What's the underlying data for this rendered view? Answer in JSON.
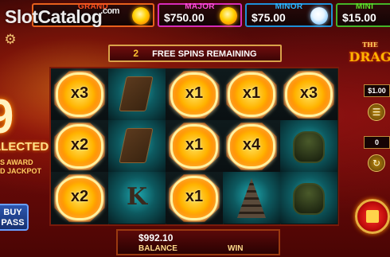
{
  "watermark": {
    "text": "SlotCatalog",
    "suffix": ".com"
  },
  "jackpots": [
    {
      "name": "GRAND",
      "value": "",
      "color": "#ff5020"
    },
    {
      "name": "MAJOR",
      "value": "$750.00",
      "color": "#ff4fd9"
    },
    {
      "name": "MINOR",
      "value": "$75.00",
      "color": "#2eb6ff"
    },
    {
      "name": "MINI",
      "value": "$15.00",
      "color": "#5fe02a"
    }
  ],
  "free_spins": {
    "count": "2",
    "label": "FREE SPINS REMAINING"
  },
  "collected": {
    "number": "9",
    "label": "LLECTED",
    "award_line1": "S AWARD",
    "award_line2": "D JACKPOT"
  },
  "buy_pass": {
    "line1": "BUY",
    "line2": "PASS"
  },
  "logo": {
    "top": "THE",
    "main": "DRAG"
  },
  "bet": {
    "value": "$1.00"
  },
  "auto": {
    "value": "0"
  },
  "balance": {
    "value": "$992.10",
    "label": "BALANCE"
  },
  "win": {
    "label": "WIN"
  },
  "reels": [
    [
      {
        "type": "orb",
        "mult": "x3"
      },
      {
        "type": "orb",
        "mult": "x2"
      },
      {
        "type": "orb",
        "mult": "x2"
      }
    ],
    [
      {
        "type": "scroll"
      },
      {
        "type": "scroll"
      },
      {
        "type": "k",
        "glyph": "K"
      }
    ],
    [
      {
        "type": "orb",
        "mult": "x1"
      },
      {
        "type": "orb",
        "mult": "x1"
      },
      {
        "type": "orb",
        "mult": "x1"
      }
    ],
    [
      {
        "type": "orb",
        "mult": "x1"
      },
      {
        "type": "orb",
        "mult": "x4"
      },
      {
        "type": "pagoda"
      }
    ],
    [
      {
        "type": "orb",
        "mult": "x3"
      },
      {
        "type": "pot"
      },
      {
        "type": "pot"
      }
    ]
  ],
  "icons": [
    "gear-icon",
    "coin-icon",
    "stack-icon",
    "refresh-icon",
    "stop-icon"
  ]
}
